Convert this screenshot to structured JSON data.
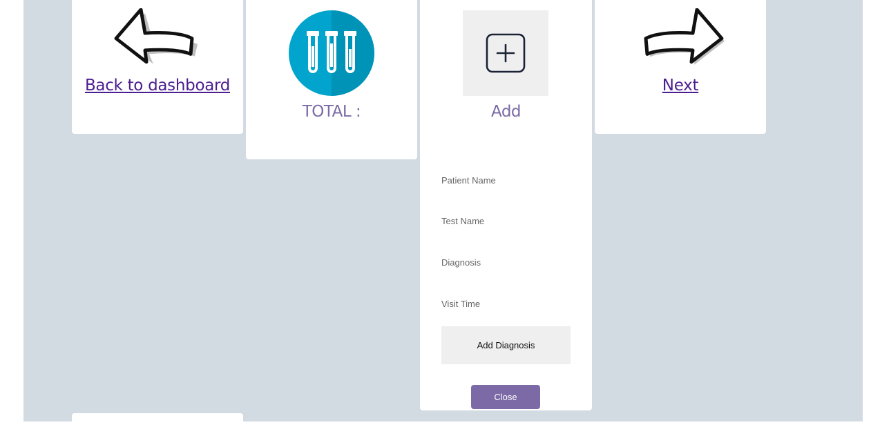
{
  "nav": {
    "back_label": "Back to dashboard",
    "next_label": "Next"
  },
  "summary": {
    "total_label": "TOTAL :"
  },
  "add_panel": {
    "heading": "Add",
    "fields": {
      "patient_name": "Patient Name",
      "test_name": "Test Name",
      "diagnosis": "Diagnosis",
      "visit_time": "Visit Time"
    },
    "submit_label": "Add Diagnosis",
    "close_label": "Close"
  },
  "icons": {
    "back": "arrow-left-icon",
    "next": "arrow-right-icon",
    "total": "test-tubes-icon",
    "add": "plus-square-icon"
  },
  "colors": {
    "background": "#d2dae2",
    "link": "#4b1d8f",
    "accent": "#7b6aa6",
    "tube_circle": "#00a4cc"
  }
}
